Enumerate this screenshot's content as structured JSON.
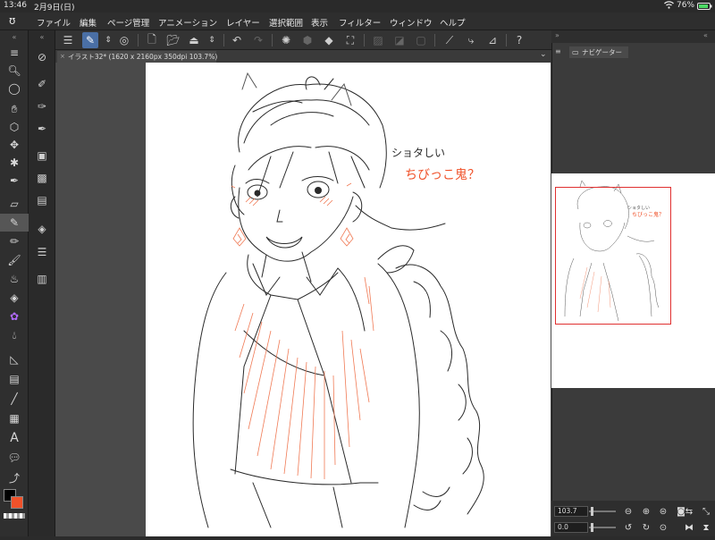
{
  "status_bar": {
    "time": "13:46",
    "date": "2月9日(日)",
    "battery": "76%",
    "wifi_icon": "wifi-icon",
    "battery_icon": "battery-icon"
  },
  "menu": {
    "items": [
      "ファイル",
      "編集",
      "ページ管理",
      "アニメーション",
      "レイヤー",
      "選択範囲",
      "表示",
      "フィルター",
      "ウィンドウ",
      "ヘルプ"
    ]
  },
  "canvas_tab": {
    "label": "イラスト32* (1620 x 2160px 350dpi 103.7%)"
  },
  "navigator": {
    "tab_label": "ナビゲーター",
    "zoom_value": "103.7",
    "rotation_value": "0.0"
  },
  "artwork": {
    "note_line1": "ショタしい",
    "note_line2": "ちびっこ鬼？"
  },
  "colors": {
    "main": "#000000",
    "sub": "#f0522a",
    "accent": "#4a6fa5",
    "frame": "#e03030"
  }
}
